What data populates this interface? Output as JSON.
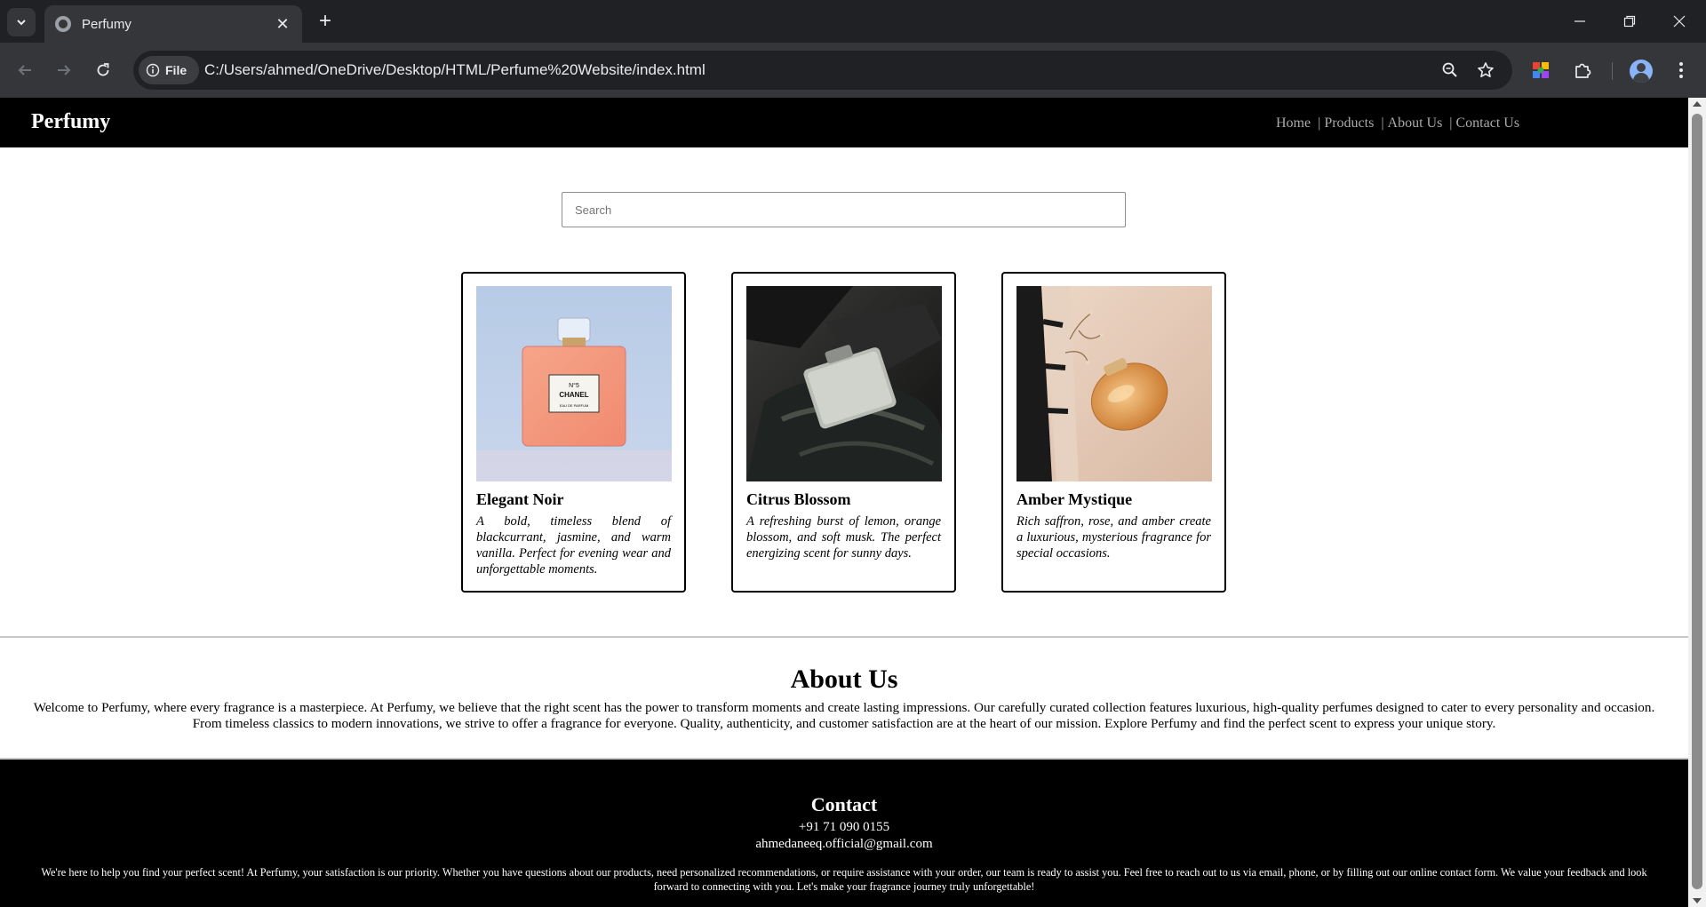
{
  "browser": {
    "tab_title": "Perfumy",
    "new_tab_symbol": "+",
    "close_symbol": "✕",
    "site_chip_label": "File",
    "url": "C:/Users/ahmed/OneDrive/Desktop/HTML/Perfume%20Website/index.html"
  },
  "site": {
    "brand": "Perfumy",
    "nav": {
      "home": "Home",
      "products": "Products",
      "about": "About Us",
      "contact": "Contact Us",
      "separator": "|"
    },
    "search": {
      "placeholder": "Search",
      "value": ""
    },
    "products": [
      {
        "name": "Elegant Noir",
        "description": "A bold, timeless blend of blackcurrant, jasmine, and warm vanilla. Perfect for evening wear and unforgettable moments.",
        "bottle_label_line1": "N°5",
        "bottle_label_line2": "CHANEL",
        "bottle_label_line3": "EAU DE PARFUM"
      },
      {
        "name": "Citrus Blossom",
        "description": "A refreshing burst of lemon, orange blossom, and soft musk. The perfect energizing scent for sunny days."
      },
      {
        "name": "Amber Mystique",
        "description": "Rich saffron, rose, and amber create a luxurious, mysterious fragrance for special occasions."
      }
    ],
    "about": {
      "title": "About Us",
      "text": "Welcome to Perfumy, where every fragrance is a masterpiece. At Perfumy, we believe that the right scent has the power to transform moments and create lasting impressions. Our carefully curated collection features luxurious, high-quality perfumes designed to cater to every personality and occasion. From timeless classics to modern innovations, we strive to offer a fragrance for everyone. Quality, authenticity, and customer satisfaction are at the heart of our mission. Explore Perfumy and find the perfect scent to express your unique story."
    },
    "contact": {
      "title": "Contact",
      "phone": "+91 71 090 0155",
      "email": "ahmedaneeq.official@gmail.com",
      "text": "We're here to help you find your perfect scent! At Perfumy, your satisfaction is our priority. Whether you have questions about our products, need personalized recommendations, or require assistance with your order, our team is ready to assist you. Feel free to reach out to us via email, phone, or by filling out our online contact form. We value your feedback and look forward to connecting with you. Let's make your fragrance journey truly unforgettable!"
    }
  },
  "colors": {
    "chrome_dark": "#202124",
    "chrome_toolbar": "#35363a",
    "header_bg": "#000000",
    "nav_link": "#a9a9a9",
    "footer_bg": "#000000"
  },
  "icons": [
    "chevron-down-icon",
    "globe-icon",
    "close-icon",
    "plus-icon",
    "minimize-icon",
    "restore-icon",
    "back-icon",
    "forward-icon",
    "reload-icon",
    "info-icon",
    "zoom-icon",
    "star-icon",
    "extension-icon",
    "puzzle-icon",
    "profile-avatar",
    "more-vert-icon"
  ]
}
